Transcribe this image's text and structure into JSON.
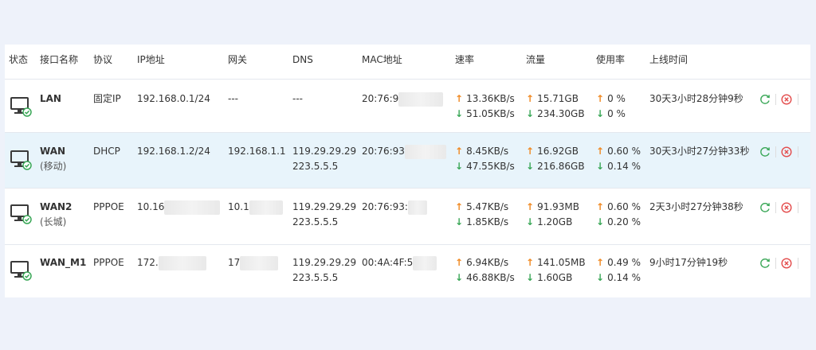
{
  "headers": {
    "status": "状态",
    "name": "接口名称",
    "protocol": "协议",
    "ip": "IP地址",
    "gateway": "网关",
    "dns": "DNS",
    "mac": "MAC地址",
    "rate": "速率",
    "traffic": "流量",
    "usage": "使用率",
    "uptime": "上线时间"
  },
  "rows": [
    {
      "name": "LAN",
      "sub": "",
      "protocol": "固定IP",
      "ip": "192.168.0.1/24",
      "gateway": "---",
      "dns1": "---",
      "dns2": "",
      "mac": "20:76:9",
      "rate_up": "13.36KB/s",
      "rate_down": "51.05KB/s",
      "traffic_up": "15.71GB",
      "traffic_down": "234.30GB",
      "usage_up": "0 %",
      "usage_down": "0 %",
      "uptime": "30天3小时28分钟9秒"
    },
    {
      "name": "WAN",
      "sub": "(移动)",
      "protocol": "DHCP",
      "ip": "192.168.1.2/24",
      "gateway": "192.168.1.1",
      "dns1": "119.29.29.29",
      "dns2": "223.5.5.5",
      "mac": "20:76:93",
      "rate_up": "8.45KB/s",
      "rate_down": "47.55KB/s",
      "traffic_up": "16.92GB",
      "traffic_down": "216.86GB",
      "usage_up": "0.60 %",
      "usage_down": "0.14 %",
      "uptime": "30天3小时27分钟33秒"
    },
    {
      "name": "WAN2",
      "sub": "(长城)",
      "protocol": "PPPOE",
      "ip": "10.16",
      "gateway": "10.1",
      "dns1": "119.29.29.29",
      "dns2": "223.5.5.5",
      "mac": "20:76:93:",
      "rate_up": "5.47KB/s",
      "rate_down": "1.85KB/s",
      "traffic_up": "91.93MB",
      "traffic_down": "1.20GB",
      "usage_up": "0.60 %",
      "usage_down": "0.20 %",
      "uptime": "2天3小时27分钟38秒"
    },
    {
      "name": "WAN_M1",
      "sub": "",
      "protocol": "PPPOE",
      "ip": "172.",
      "gateway": "17",
      "dns1": "119.29.29.29",
      "dns2": "223.5.5.5",
      "mac": "00:4A:4F:5",
      "rate_up": "6.94KB/s",
      "rate_down": "46.88KB/s",
      "traffic_up": "141.05MB",
      "traffic_down": "1.60GB",
      "usage_up": "0.49 %",
      "usage_down": "0.14 %",
      "uptime": "9小时17分钟19秒"
    }
  ],
  "glyphs": {
    "up_arrow": "↑",
    "down_arrow": "↓"
  },
  "icons": {
    "monitor": "monitor-icon",
    "status_ok": "check-circle-icon",
    "refresh": "refresh-icon",
    "disconnect": "close-circle-icon"
  },
  "colors": {
    "page_bg": "#eef2fa",
    "selected_row_bg": "#e8f4fb",
    "up_arrow": "#f08a24",
    "down_arrow": "#3aa757",
    "refresh_icon": "#3aa757",
    "disconnect_icon": "#e34b4b",
    "status_ok": "#3aa757"
  }
}
